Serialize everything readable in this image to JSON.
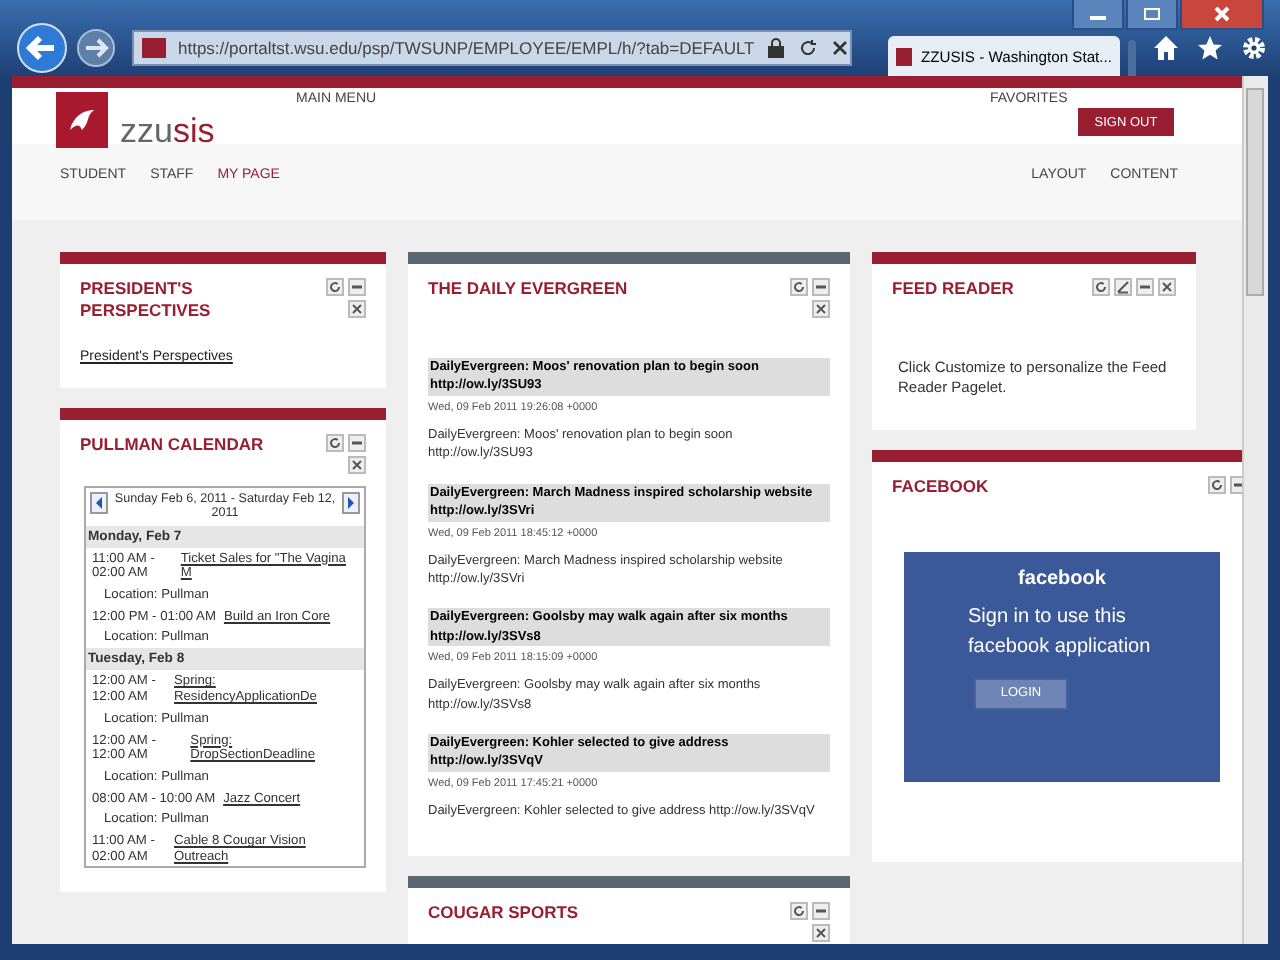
{
  "browser": {
    "address": "https://portaltst.wsu.edu/psp/TWSUNP/EMPLOYEE/EMPL/h/?tab=DEFAULT",
    "tab_title": "ZZUSIS - Washington Stat..."
  },
  "header": {
    "logo_prefix": "zzu",
    "logo_suffix": "sis",
    "main_menu": "MAIN MENU",
    "favorites": "FAVORITES",
    "sign_out": "SIGN OUT",
    "nav": [
      {
        "label": "STUDENT",
        "selected": false
      },
      {
        "label": "STAFF",
        "selected": false
      },
      {
        "label": "MY PAGE",
        "selected": true
      }
    ],
    "nav_right": [
      "LAYOUT",
      "CONTENT"
    ]
  },
  "columns": [
    [
      {
        "kind": "link",
        "title": "PRESIDENT'S PERSPECTIVES",
        "color": "#981e32",
        "buttons": [
          {
            "kind": "refresh"
          },
          {
            "kind": "minimize"
          },
          {
            "kind": "close"
          }
        ],
        "link": "President's Perspectives"
      },
      {
        "kind": "calendar",
        "title": "PULLMAN CALENDAR",
        "color": "#981e32",
        "buttons": [
          {
            "kind": "refresh"
          },
          {
            "kind": "minimize"
          },
          {
            "kind": "close"
          }
        ],
        "range": "Sunday Feb 6, 2011 - Saturday Feb 12, 2011",
        "days": [
          {
            "day": "Monday, Feb 7",
            "events": [
              {
                "time": "11:00 AM - 02:00 AM",
                "title": "Ticket Sales for \"The Vagina M",
                "location": "Location: Pullman"
              },
              {
                "time": "12:00 PM - 01:00 AM",
                "title": "Build an Iron Core",
                "location": "Location: Pullman"
              }
            ]
          },
          {
            "day": "Tuesday, Feb 8",
            "events": [
              {
                "time": "12:00 AM - 12:00 AM",
                "title": "Spring: ResidencyApplicationDe",
                "location": "Location: Pullman"
              },
              {
                "time": "12:00 AM - 12:00 AM",
                "title": "Spring: DropSectionDeadline",
                "location": "Location: Pullman"
              },
              {
                "time": "08:00 AM - 10:00 AM",
                "title": "Jazz Concert",
                "location": "Location: Pullman"
              },
              {
                "time": "11:00 AM - 02:00 AM",
                "title": "Cable 8 Cougar Vision Outreach"
              }
            ]
          }
        ]
      }
    ],
    [
      {
        "kind": "feed",
        "title": "THE DAILY EVERGREEN",
        "color": "#5a6770",
        "buttons": [
          {
            "kind": "refresh"
          },
          {
            "kind": "minimize"
          },
          {
            "kind": "close"
          }
        ],
        "items": [
          {
            "headline": "DailyEvergreen: Moos' renovation plan to begin soon http://ow.ly/3SU93",
            "date": "Wed, 09 Feb 2011 19:26:08 +0000",
            "body": "DailyEvergreen: Moos' renovation plan to begin soon http://ow.ly/3SU93"
          },
          {
            "headline": "DailyEvergreen: March Madness inspired scholarship website http://ow.ly/3SVri",
            "date": "Wed, 09 Feb 2011 18:45:12 +0000",
            "body": "DailyEvergreen: March Madness inspired scholarship website http://ow.ly/3SVri"
          },
          {
            "headline": "DailyEvergreen: Goolsby may walk again after six months http://ow.ly/3SVs8",
            "date": "Wed, 09 Feb 2011 18:15:09 +0000",
            "body": "DailyEvergreen: Goolsby may walk again after six months http://ow.ly/3SVs8"
          },
          {
            "headline": "DailyEvergreen: Kohler selected to give address http://ow.ly/3SVqV",
            "date": "Wed, 09 Feb 2011 17:45:21 +0000",
            "body": "DailyEvergreen: Kohler selected to give address http://ow.ly/3SVqV"
          }
        ]
      },
      {
        "kind": "cut",
        "title": "COUGAR SPORTS",
        "color": "#5a6770",
        "buttons": [
          {
            "kind": "refresh"
          },
          {
            "kind": "minimize"
          },
          {
            "kind": "close"
          }
        ]
      }
    ],
    [
      {
        "kind": "text",
        "title": "FEED READER",
        "color": "#981e32",
        "buttons": [
          {
            "kind": "refresh"
          },
          {
            "kind": "edit"
          },
          {
            "kind": "minimize"
          },
          {
            "kind": "close"
          }
        ],
        "text": "Click Customize to personalize the Feed Reader Pagelet."
      },
      {
        "kind": "facebook",
        "title": "FACEBOOK",
        "color": "#981e32",
        "buttons": [
          {
            "kind": "refresh"
          },
          {
            "kind": "minimize"
          }
        ],
        "logo": "facebook",
        "message": "Sign in to use this facebook application",
        "login": "LOGIN"
      }
    ]
  ]
}
